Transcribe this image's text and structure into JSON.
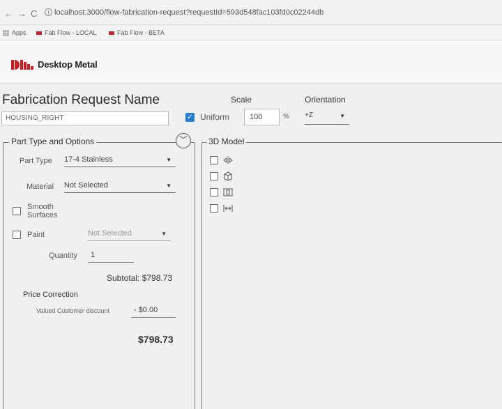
{
  "browser": {
    "url": "localhost:3000/flow-fabrication-request?requestId=593d548fac103fd0c02244db",
    "bookmarks": [
      "Apps",
      "Fab Flow - LOCAL",
      "Fab Flow - BETA"
    ]
  },
  "brand": {
    "name": "Desktop Metal",
    "color": "#c62026"
  },
  "request": {
    "title": "Fabrication Request Name",
    "name_value": "HOUSING_RIGHT"
  },
  "scale": {
    "label": "Scale",
    "uniform_label": "Uniform",
    "uniform_checked": true,
    "value": "100",
    "unit": "%"
  },
  "orientation": {
    "label": "Orientation",
    "value": "+Z"
  },
  "options": {
    "legend": "Part Type and Options",
    "part_type_label": "Part Type",
    "part_type_value": "17-4 Stainless",
    "material_label": "Material",
    "material_value": "Not Selected",
    "smooth_label_1": "Smooth",
    "smooth_label_2": "Surfaces",
    "paint_label": "Paint",
    "paint_value": "Not Selected",
    "quantity_label": "Quantity",
    "quantity_value": "1",
    "subtotal": "Subtotal: $798.73",
    "price_correction_label": "Price Correction",
    "discount_label": "Valued Customer discount",
    "discount_value": "- $0.00",
    "total": "$798.73"
  },
  "model": {
    "legend": "3D Model",
    "tools": [
      "split-axis-icon",
      "cube-icon",
      "box-side-icon",
      "fit-width-icon"
    ]
  },
  "colors": {
    "checkbox_accent": "#2a7fcc"
  }
}
